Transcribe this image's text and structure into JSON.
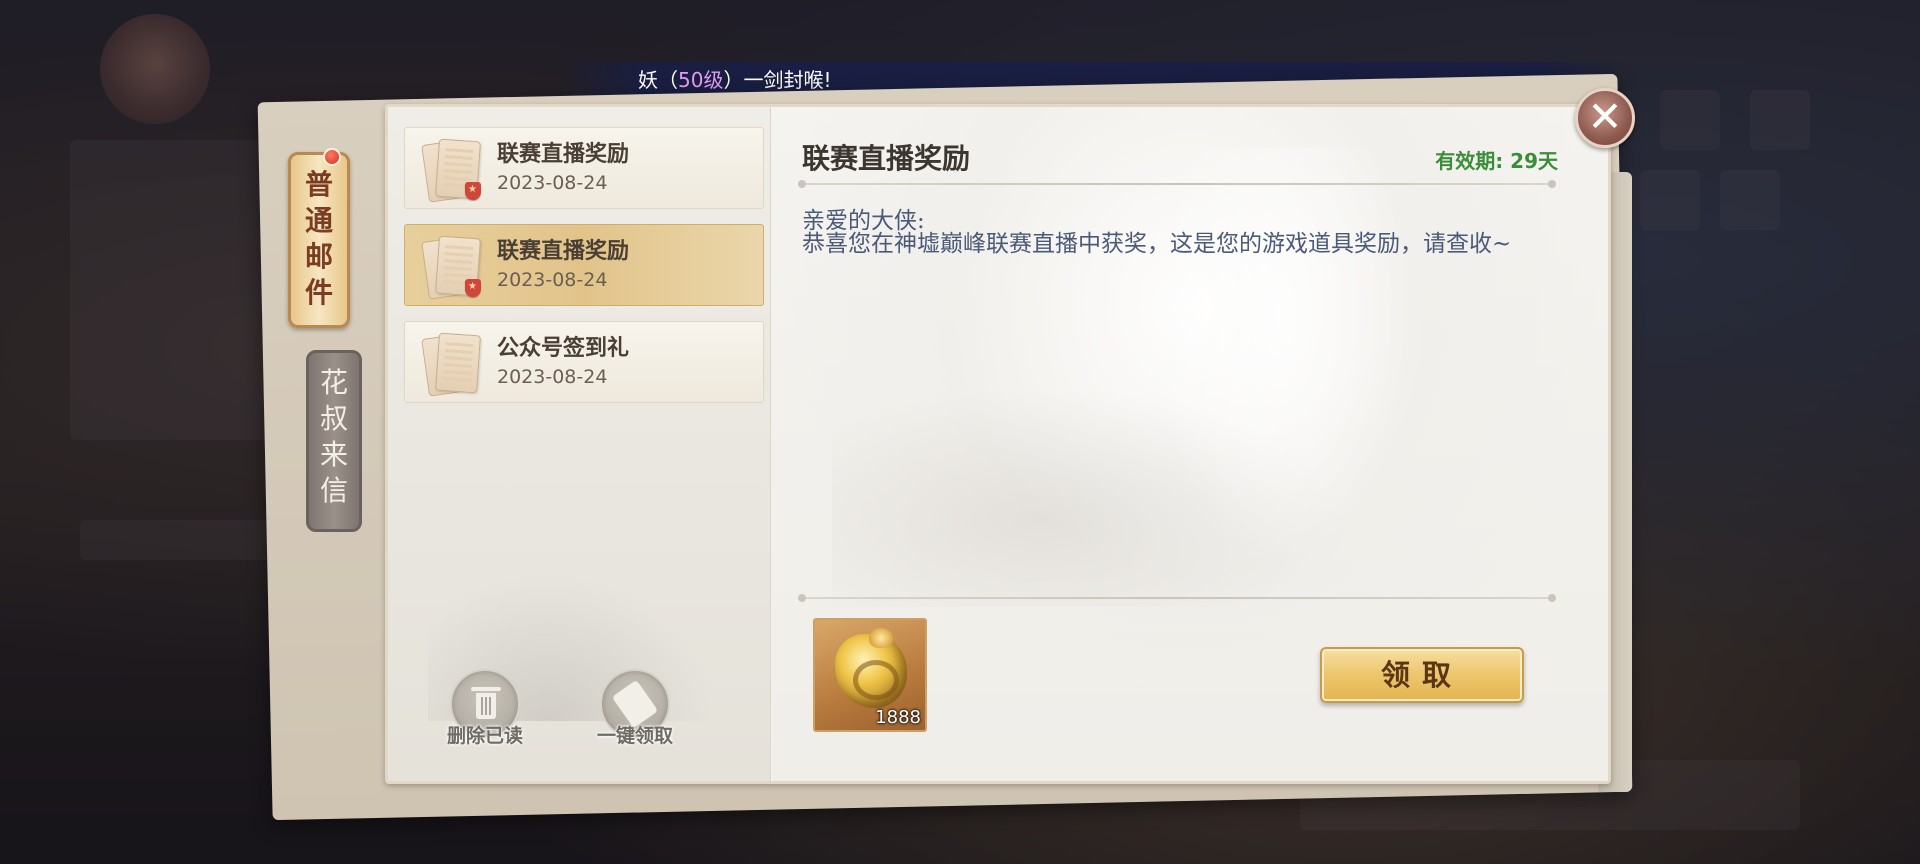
{
  "marquee": {
    "prefix": "妖（",
    "level": "50级",
    "suffix": "）一剑封喉!"
  },
  "tabs": {
    "active": [
      "普",
      "通",
      "邮",
      "件"
    ],
    "inactive": [
      "花",
      "叔",
      "来",
      "信"
    ]
  },
  "mail_list": [
    {
      "title": "联赛直播奖励",
      "date": "2023-08-24",
      "selected": false
    },
    {
      "title": "联赛直播奖励",
      "date": "2023-08-24",
      "selected": true
    },
    {
      "title": "公众号签到礼",
      "date": "2023-08-24",
      "selected": false
    }
  ],
  "actions": {
    "delete_read": "删除已读",
    "claim_all": "一键领取"
  },
  "detail": {
    "title": "联赛直播奖励",
    "validity": "有效期: 29天",
    "greeting": "亲爱的大侠:",
    "body": "恭喜您在神墟巅峰联赛直播中获奖，这是您的游戏道具奖励，请查收~"
  },
  "reward": {
    "icon": "golden-dragon-icon",
    "count": "1888"
  },
  "claim_button": "领取",
  "close_icon": "✕",
  "colors": {
    "validity": "#3a8e3a",
    "body_text": "#4a5a78",
    "active_tab": "#e8c78a",
    "claim_button": "#edc870"
  }
}
